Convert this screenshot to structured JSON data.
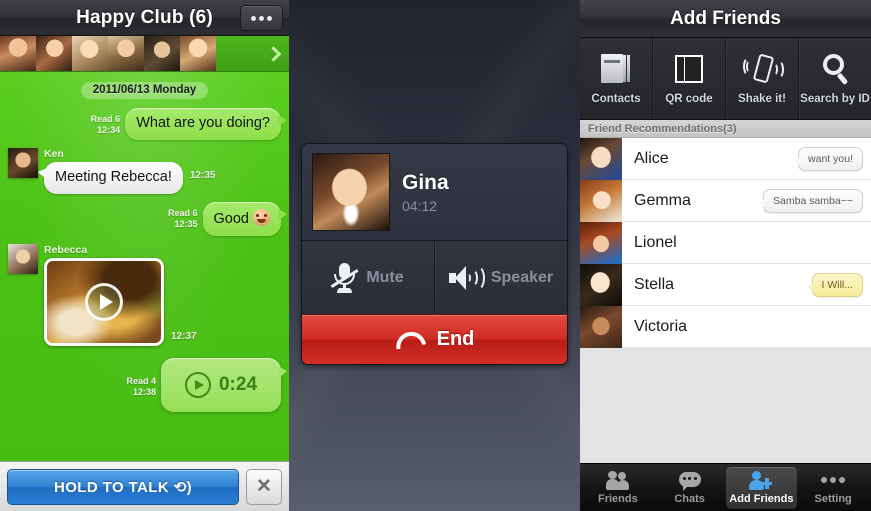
{
  "chat_panel": {
    "title": "Happy Club (6)",
    "more_icon": "more-dots-icon",
    "member_count": 6,
    "strip_arrow_icon": "chevron-right-icon",
    "date_divider": "2011/06/13 Monday",
    "messages": [
      {
        "side": "out",
        "type": "text",
        "text": "What are you doing?",
        "read": "Read 6",
        "time": "12:34"
      },
      {
        "side": "in",
        "type": "text",
        "sender": "Ken",
        "text": "Meeting Rebecca!",
        "time": "12:35"
      },
      {
        "side": "out",
        "type": "text",
        "text": "Good",
        "emoji": "smiley-face-icon",
        "read": "Read 6",
        "time": "12:35"
      },
      {
        "side": "in",
        "type": "photo",
        "sender": "Rebecca",
        "play_icon": "play-icon",
        "time": "12:37"
      },
      {
        "side": "out",
        "type": "voice",
        "duration": "0:24",
        "play_icon": "play-circle-icon",
        "read": "Read 4",
        "time": "12:38"
      }
    ],
    "footer": {
      "talk_label": "HOLD TO TALK ⟲)",
      "talk_text": "HOLD TO TALK",
      "close_label": "✕",
      "close_icon": "close-icon"
    }
  },
  "call_panel": {
    "callee_name": "Gina",
    "call_duration": "04:12",
    "avatar_icon": "caller-avatar",
    "mute_label": "Mute",
    "mute_icon": "microphone-muted-icon",
    "speaker_label": "Speaker",
    "speaker_icon": "speaker-icon",
    "end_label": "End",
    "end_icon": "handset-icon",
    "end_color": "#cf2a22"
  },
  "add_panel": {
    "title": "Add Friends",
    "tabs": [
      {
        "label": "Contacts",
        "icon": "contacts-book-icon"
      },
      {
        "label": "QR code",
        "icon": "qr-code-icon"
      },
      {
        "label": "Shake it!",
        "icon": "shake-phone-icon"
      },
      {
        "label": "Search by ID",
        "icon": "search-icon"
      }
    ],
    "section_header": "Friend Recommendations(3)",
    "friends": [
      {
        "name": "Alice",
        "tag": "want you!",
        "tag_style": "white"
      },
      {
        "name": "Gemma",
        "tag": "Samba samba~~",
        "tag_style": "white"
      },
      {
        "name": "Lionel",
        "tag": "",
        "tag_style": "none"
      },
      {
        "name": "Stella",
        "tag": "I Will...",
        "tag_style": "yellow"
      },
      {
        "name": "Victoria",
        "tag": "",
        "tag_style": "none"
      }
    ],
    "tabbar": [
      {
        "label": "Friends",
        "icon": "friends-icon",
        "active": false
      },
      {
        "label": "Chats",
        "icon": "chat-bubble-icon",
        "active": false
      },
      {
        "label": "Add Friends",
        "icon": "add-friend-icon",
        "active": true
      },
      {
        "label": "Setting",
        "icon": "more-dots-icon",
        "active": false
      }
    ],
    "accent_color": "#4aa3e8"
  }
}
